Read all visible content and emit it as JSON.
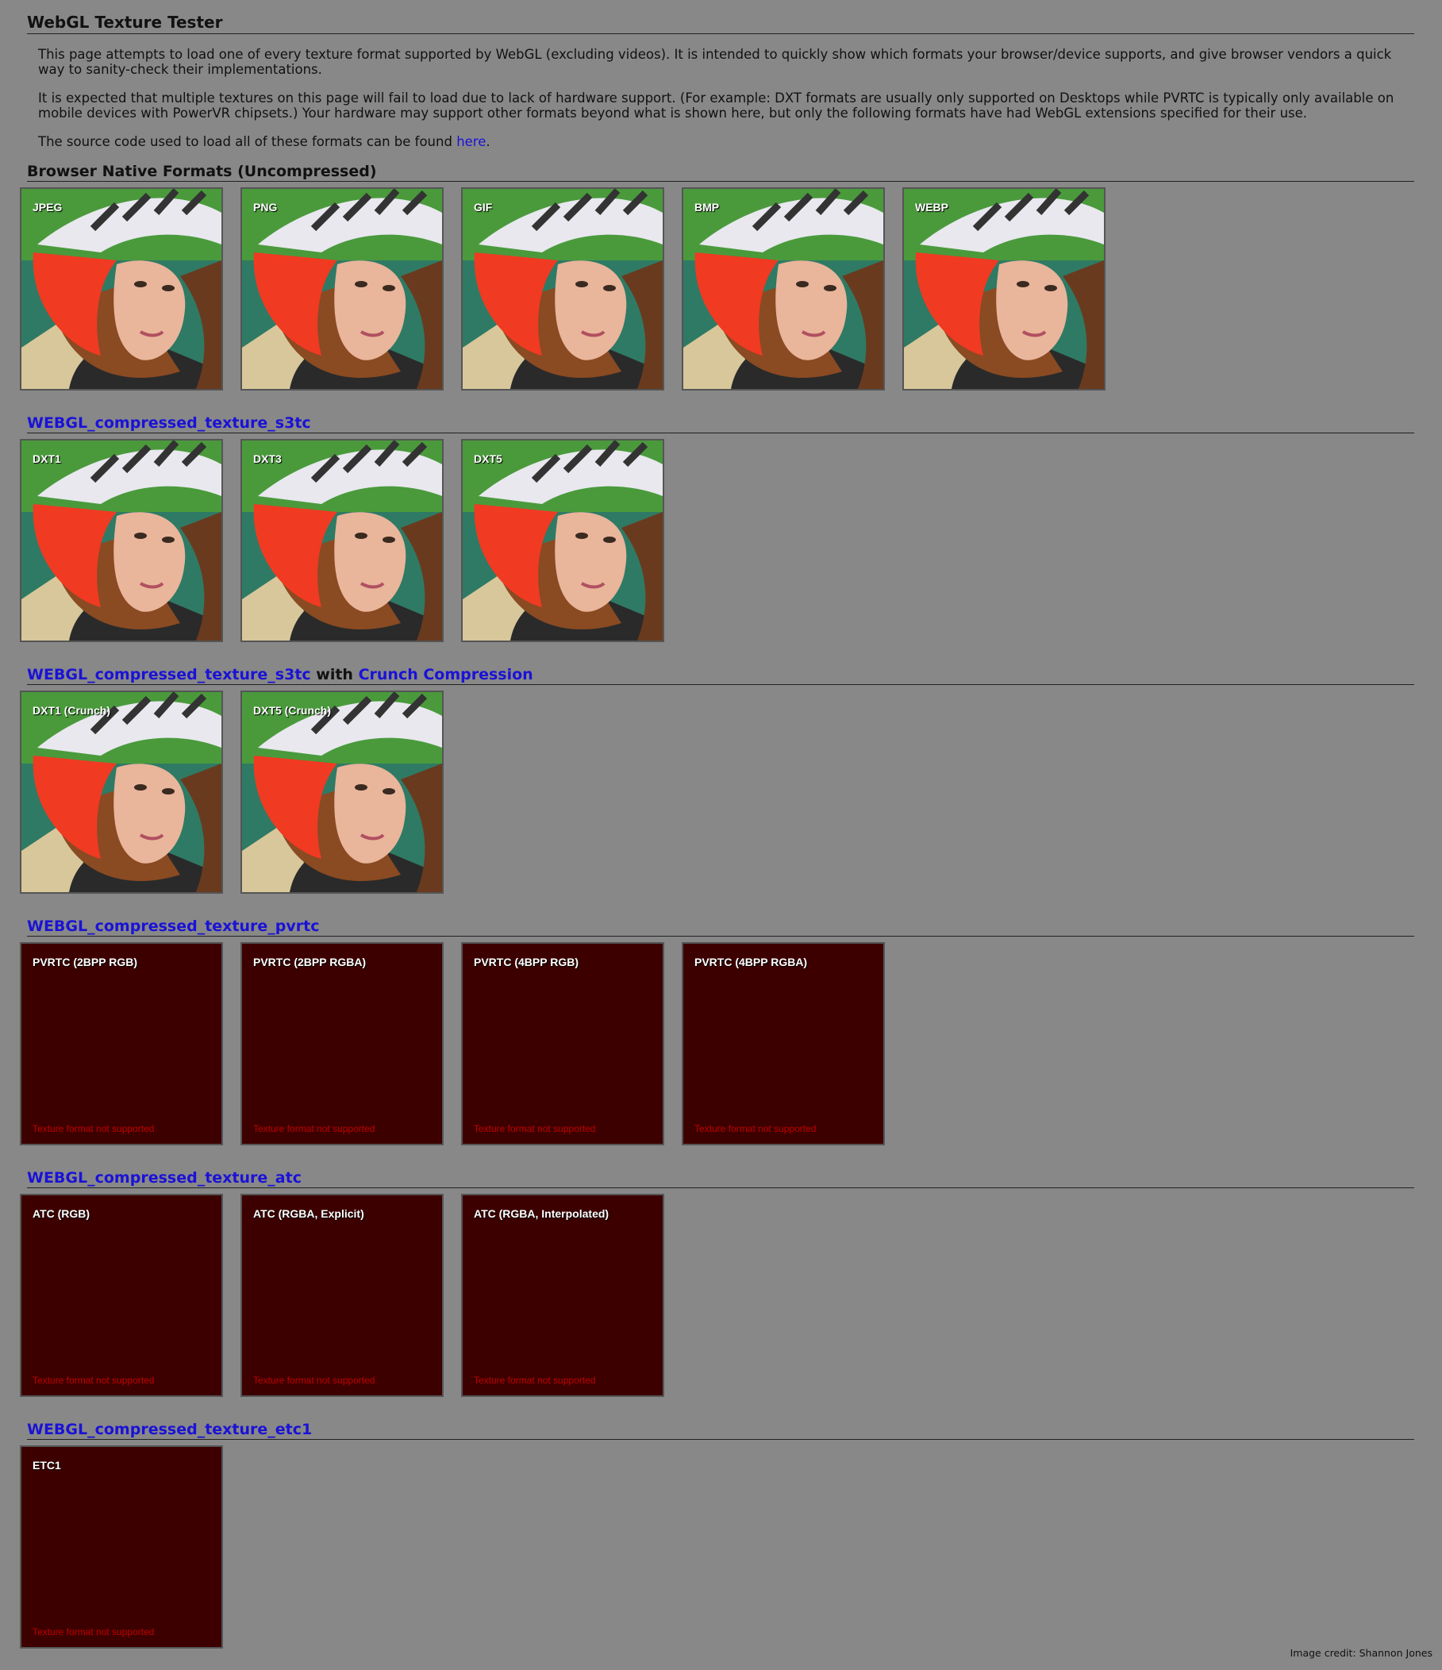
{
  "title": "WebGL Texture Tester",
  "intro": {
    "p1": "This page attempts to load one of every texture format supported by WebGL (excluding videos). It is intended to quickly show which formats your browser/device supports, and give browser vendors a quick way to sanity-check their implementations.",
    "p2": "It is expected that multiple textures on this page will fail to load due to lack of hardware support. (For example: DXT formats are usually only supported on Desktops while PVRTC is typically only available on mobile devices with PowerVR chipsets.) Your hardware may support other formats beyond what is shown here, but only the following formats have had WebGL extensions specified for their use.",
    "p3_prefix": "The source code used to load all of these formats can be found ",
    "p3_link": "here",
    "p3_suffix": "."
  },
  "error_text": "Texture format not supported",
  "sections": [
    {
      "heading": "Browser Native Formats (Uncompressed)",
      "tiles": [
        "JPEG",
        "PNG",
        "GIF",
        "BMP",
        "WEBP"
      ]
    },
    {
      "heading": "WEBGL_compressed_texture_s3tc",
      "tiles": [
        "DXT1",
        "DXT3",
        "DXT5"
      ]
    },
    {
      "heading_link1": "WEBGL_compressed_texture_s3tc",
      "heading_mid": " with ",
      "heading_link2": "Crunch Compression",
      "tiles": [
        "DXT1 (Crunch)",
        "DXT5 (Crunch)"
      ]
    },
    {
      "heading": "WEBGL_compressed_texture_pvrtc",
      "tiles": [
        "PVRTC (2BPP RGB)",
        "PVRTC (2BPP RGBA)",
        "PVRTC (4BPP RGB)",
        "PVRTC (4BPP RGBA)"
      ]
    },
    {
      "heading": "WEBGL_compressed_texture_atc",
      "tiles": [
        "ATC (RGB)",
        "ATC (RGBA, Explicit)",
        "ATC (RGBA, Interpolated)"
      ]
    },
    {
      "heading": "WEBGL_compressed_texture_etc1",
      "tiles": [
        "ETC1"
      ]
    }
  ],
  "credit": "Image credit: Shannon Jones",
  "colors": {
    "background": "#888888",
    "link": "#1a12d6",
    "unsupported_tile": "#3d0000",
    "error_text": "#c00000"
  }
}
